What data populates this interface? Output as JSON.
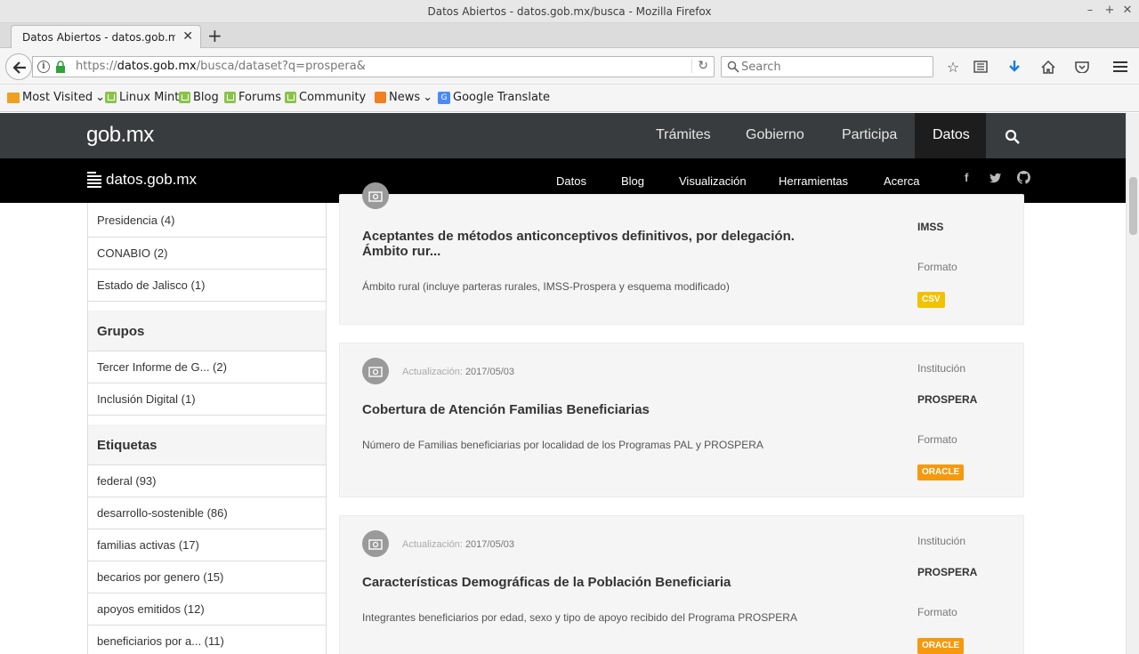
{
  "window": {
    "title": "Datos Abiertos - datos.gob.mx/busca - Mozilla Firefox",
    "controls": {
      "minimize": "–",
      "maximize": "+",
      "close": "✕"
    }
  },
  "tabs": [
    {
      "title": "Datos Abiertos - datos.gob.mx/b",
      "close": "✕"
    }
  ],
  "new_tab": "+",
  "navbar": {
    "url_prefix": "https://",
    "url_host": "datos.gob.mx",
    "url_path": "/busca/dataset?q=prospera&",
    "search_placeholder": "Search",
    "info_icon": "i",
    "reload": "↻"
  },
  "toolbar_icons": [
    "star-icon",
    "reading-list-icon",
    "download-icon",
    "home-icon",
    "pocket-icon",
    "menu-icon"
  ],
  "bookmarks": [
    {
      "label": "Most Visited",
      "icon": "folder-icon",
      "dropdown": true
    },
    {
      "label": "Linux Mint",
      "icon": "mint-icon"
    },
    {
      "label": "Blog",
      "icon": "mint-icon"
    },
    {
      "label": "Forums",
      "icon": "mint-icon"
    },
    {
      "label": "Community",
      "icon": "mint-icon"
    },
    {
      "label": "News",
      "icon": "rss-icon",
      "dropdown": true
    },
    {
      "label": "Google Translate",
      "icon": "google-translate-icon"
    }
  ],
  "gob": {
    "logo": "gob.mx",
    "nav": [
      "Trámites",
      "Gobierno",
      "Participa",
      "Datos"
    ],
    "active": "Datos"
  },
  "datos": {
    "logo": "datos.gob.mx",
    "nav": [
      "Datos",
      "Blog",
      "Visualización",
      "Herramientas",
      "Acerca"
    ],
    "social": [
      "f",
      "t",
      "gh"
    ]
  },
  "sidebar": {
    "org_items": [
      "Presidencia (4)",
      "CONABIO (2)",
      "Estado de Jalisco (1)"
    ],
    "groups_title": "Grupos",
    "groups": [
      "Tercer Informe de G... (2)",
      "Inclusión Digital (1)"
    ],
    "tags_title": "Etiquetas",
    "tags": [
      "federal (93)",
      "desarrollo-sostenible (86)",
      "familias activas (17)",
      "becarios por genero (15)",
      "apoyos emitidos (12)",
      "beneficiarios por a... (11)"
    ]
  },
  "results": [
    {
      "title": "Aceptantes de métodos anticonceptivos definitivos, por delegación. Ámbito rur...",
      "description": "Ámbito rural (incluye parteras rurales, IMSS-Prospera y esquema modificado)",
      "institution": "IMSS",
      "format_label": "Formato",
      "format": "CSV",
      "format_color": "#f2c200"
    },
    {
      "update_label": "Actualización:",
      "date": "2017/05/03",
      "title": "Cobertura de Atención Familias Beneficiarias",
      "description": "Número de Familias beneficiarias por localidad de los Programas PAL y PROSPERA",
      "institution_label": "Institución",
      "institution": "PROSPERA",
      "format_label": "Formato",
      "format": "ORACLE",
      "format_color": "#f59a0e"
    },
    {
      "update_label": "Actualización:",
      "date": "2017/05/03",
      "title": "Características Demográficas de la Población Beneficiaria",
      "description": "Integrantes beneficiarios por edad, sexo y tipo de apoyo recibido del Programa PROSPERA",
      "institution_label": "Institución",
      "institution": "PROSPERA",
      "format_label": "Formato",
      "format": "ORACLE",
      "format_color": "#f59a0e"
    }
  ]
}
